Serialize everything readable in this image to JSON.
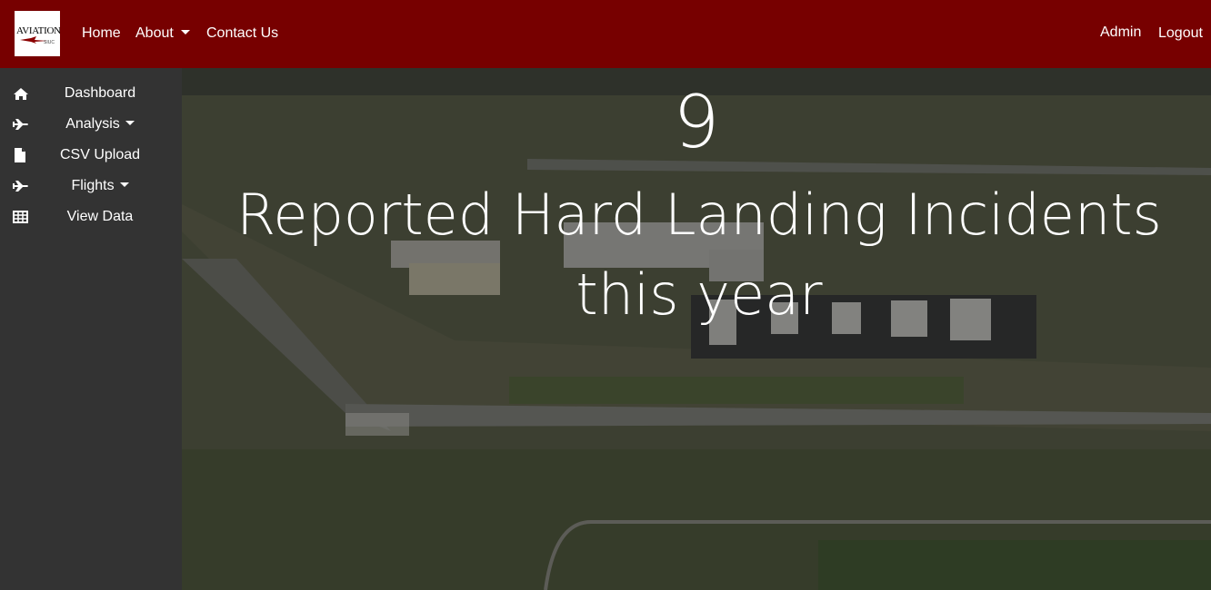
{
  "navbar": {
    "logo_text": "AVIATION",
    "logo_subtext": "SIUC",
    "home": "Home",
    "about": "About",
    "contact": "Contact Us",
    "admin": "Admin",
    "logout": "Logout",
    "background_color": "#770000"
  },
  "sidebar": {
    "items": [
      {
        "label": "Dashboard",
        "icon": "home-icon"
      },
      {
        "label": "Analysis",
        "icon": "plane-icon",
        "dropdown": true
      },
      {
        "label": "CSV Upload",
        "icon": "file-icon"
      },
      {
        "label": "Flights",
        "icon": "plane-icon",
        "dropdown": true
      },
      {
        "label": "View Data",
        "icon": "table-icon"
      }
    ]
  },
  "main": {
    "incident_count": "9",
    "incident_caption": "Reported Hard Landing Incidents this year",
    "background": "aerial airport photo"
  }
}
